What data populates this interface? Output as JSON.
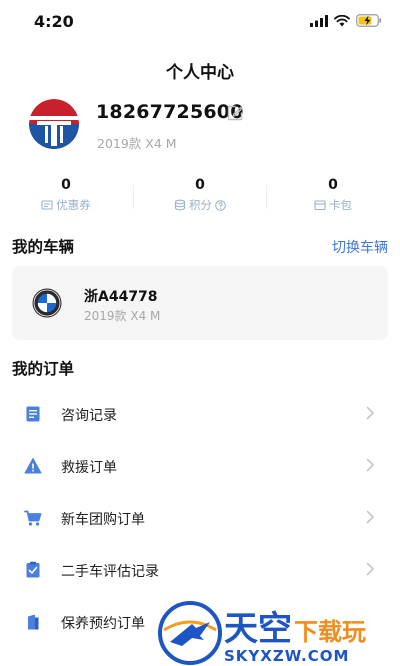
{
  "status_bar": {
    "time": "4:20"
  },
  "header": {
    "title": "个人中心"
  },
  "profile": {
    "phone": "18267725600",
    "subtitle": "2019款 X4 M"
  },
  "stats": [
    {
      "value": "0",
      "label": "优惠券",
      "icon": "coupon-icon"
    },
    {
      "value": "0",
      "label": "积分",
      "icon": "points-icon"
    },
    {
      "value": "0",
      "label": "卡包",
      "icon": "card-wallet-icon"
    }
  ],
  "vehicles_section": {
    "title": "我的车辆",
    "switch_label": "切换车辆"
  },
  "vehicle": {
    "plate": "浙A44778",
    "model": "2019款 X4 M",
    "brand_icon": "bmw-logo"
  },
  "orders_section": {
    "title": "我的订单"
  },
  "orders": [
    {
      "label": "咨询记录",
      "icon": "consult-record-icon"
    },
    {
      "label": "救援订单",
      "icon": "rescue-warning-icon"
    },
    {
      "label": "新车团购订单",
      "icon": "cart-icon"
    },
    {
      "label": "二手车评估记录",
      "icon": "evaluation-icon"
    },
    {
      "label": "保养预约订单",
      "icon": "maintenance-icon"
    }
  ],
  "watermark": {
    "title": "天空下载玩",
    "site": "SKYXZW.COM"
  },
  "colors": {
    "accent": "#3f78d6",
    "icon_blue": "#4a7fdc",
    "label_gray": "#a8a8a8"
  }
}
